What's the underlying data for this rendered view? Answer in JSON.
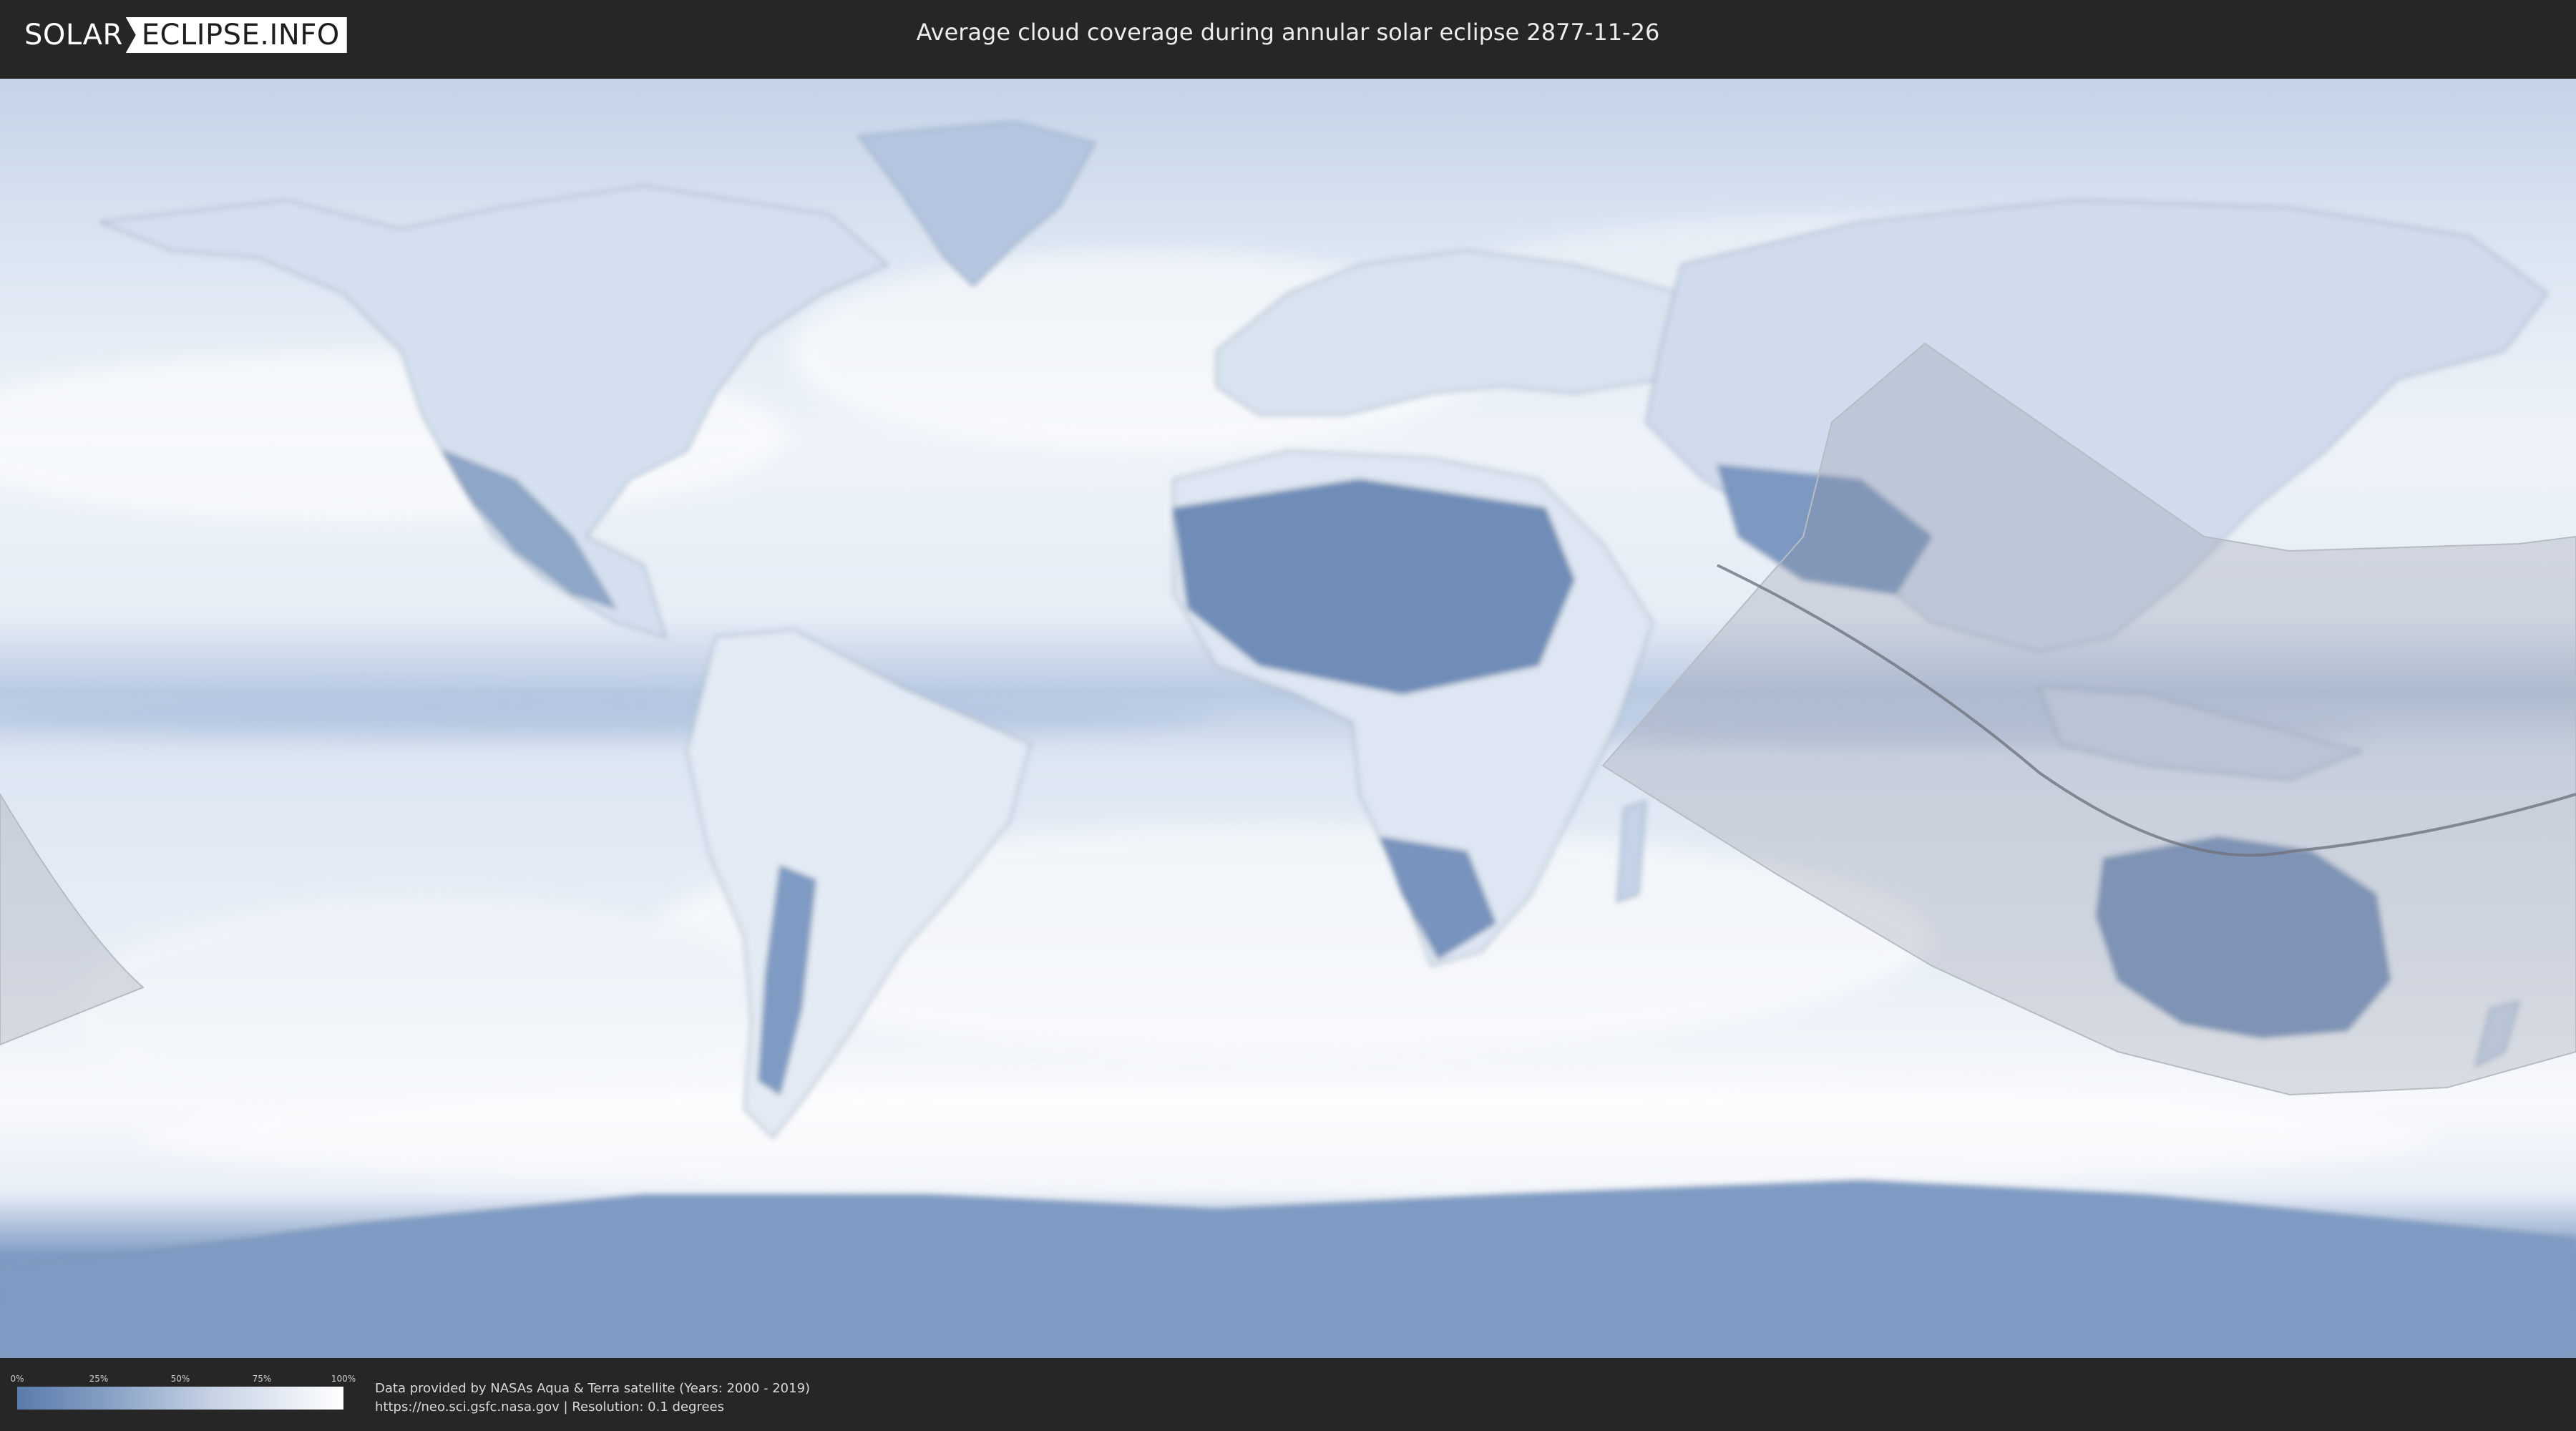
{
  "header": {
    "logo_part1": "SOLAR",
    "logo_part2": "ECLIPSE.INFO",
    "title": "Average cloud coverage during annular solar eclipse 2877-11-26"
  },
  "legend": {
    "ticks": [
      "0%",
      "25%",
      "50%",
      "75%",
      "100%"
    ],
    "colors": [
      "#5a7bab",
      "#8aa3c6",
      "#c7d3e5",
      "#ffffff"
    ]
  },
  "credits": {
    "line1": "Data provided by NASAs Aqua & Terra satellite (Years: 2000 - 2019)",
    "line2": "https://neo.sci.gsfc.nasa.gov | Resolution: 0.1 degrees"
  },
  "map": {
    "ocean_color": "#dbe5f1",
    "land_cloud_color": "#6f8db8",
    "eclipse_zone_color": "#a0a6b0"
  }
}
